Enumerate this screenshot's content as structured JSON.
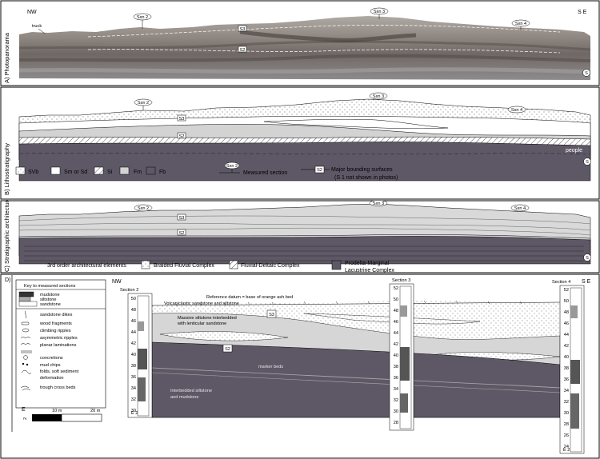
{
  "panels": [
    {
      "title": "A) Photopanorama",
      "nw": "NW",
      "se": "S E",
      "truck": "truck",
      "sections": [
        "Sxn 2",
        "Sxn 3",
        "Sxn 4"
      ],
      "surfaces": [
        "S2",
        "S3"
      ],
      "circle": "S"
    },
    {
      "title": "B) Lithostratigraphy",
      "sections": [
        "Sxn 2",
        "Sxn 3",
        "Sxn 4"
      ],
      "surfaces": [
        "S2",
        "S3"
      ],
      "people": "people",
      "circle": "S",
      "legend": [
        {
          "code": "SVb"
        },
        {
          "code": "Sm or Sd"
        },
        {
          "code": "Si"
        },
        {
          "code": "Fm"
        },
        {
          "code": "Fb"
        }
      ],
      "measured_section_label": "Measured section",
      "measured_section_icon": "Sxn 2",
      "bounding_icon": "S2",
      "bounding_label": "Major bounding surfaces",
      "bounding_note": "(S 1 not shown in photos)"
    },
    {
      "title": "C) Stratigraphic architecture",
      "sections": [
        "Sxn 2",
        "Sxn 3",
        "Sxn 4"
      ],
      "surfaces": [
        "S2",
        "S3"
      ],
      "circle": "S",
      "elements_label": "3rd order architectural elements",
      "elements": [
        {
          "label": "Braided Fluvial Complex"
        },
        {
          "label": "Fluvial-Deltaic Complex"
        },
        {
          "label": "Prodelta-Marginal",
          "label2": "Lacustrine Complex"
        }
      ]
    }
  ],
  "panel_d": {
    "label": "D)",
    "nw": "NW",
    "se": "S E",
    "key_title": "Key to measured sections",
    "key_items": [
      "mudstone",
      "siltstone",
      "sandstone",
      "sandstone dikes",
      "wood fragments",
      "climbing ripples",
      "asymmetric ripples",
      "planar laminations",
      "concretions",
      "mud chips",
      "folds, soft sediment",
      "deformation",
      "trough cross beds"
    ],
    "scale": {
      "e": "E",
      "z": "2",
      "m10": "10 m",
      "m20": "20 m"
    },
    "section2": {
      "title": "Section 2",
      "ticks": [
        "50",
        "48",
        "46",
        "44",
        "42",
        "40",
        "38",
        "36",
        "34",
        "32",
        "30"
      ],
      "base": "E 2"
    },
    "section3": {
      "title": "Section 3",
      "ticks": [
        "52",
        "50",
        "48",
        "46",
        "44",
        "42",
        "40",
        "38",
        "36",
        "34",
        "32",
        "30",
        "28"
      ]
    },
    "section4": {
      "title": "Section 4",
      "ticks": [
        "52",
        "50",
        "48",
        "46",
        "44",
        "42",
        "40",
        "38",
        "36",
        "34",
        "32",
        "30",
        "28",
        "26",
        "24"
      ],
      "base": "E 2"
    },
    "datum": "Reference datum = base of orange ash bed",
    "volcaniclastic": "Volcaniclastic sandstone and siltstone",
    "massive1": "Massive siltstone interbedded",
    "massive2": "with lenticular sandstone",
    "marker": "marker beds",
    "inter1": "Interbedded siltstone",
    "inter2": "and mudstone",
    "s2": "S2",
    "s3": "S3"
  }
}
